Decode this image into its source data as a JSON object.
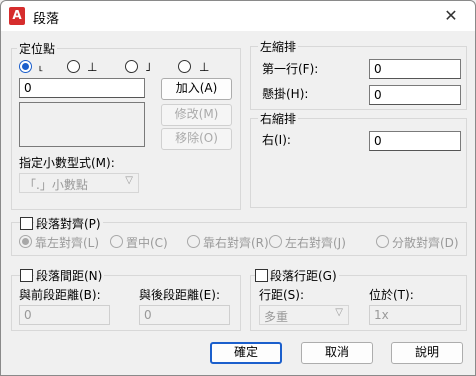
{
  "window": {
    "title": "段落",
    "app_icon_letter": "A",
    "close_glyph": "✕"
  },
  "tab_stops": {
    "label": "定位點",
    "types": [
      {
        "glyph": "˪",
        "selected": true
      },
      {
        "glyph": "⊥",
        "selected": false
      },
      {
        "glyph": "˩",
        "selected": false
      },
      {
        "glyph": "⊥",
        "selected": false
      }
    ],
    "position_value": "0",
    "add_button": "加入(A)",
    "modify_button": "修改(M)",
    "remove_button": "移除(O)",
    "decimal_label": "指定小數型式(M):",
    "decimal_value": "「.」小數點"
  },
  "left_indent": {
    "label": "左縮排",
    "first_line_label": "第一行(F):",
    "first_line_value": "0",
    "hanging_label": "懸掛(H):",
    "hanging_value": "0"
  },
  "right_indent": {
    "label": "右縮排",
    "right_label": "右(I):",
    "right_value": "0"
  },
  "alignment": {
    "label": "段落對齊(P)",
    "options": [
      "靠左對齊(L)",
      "置中(C)",
      "靠右對齊(R)",
      "左右對齊(J)",
      "分散對齊(D)"
    ]
  },
  "spacing": {
    "label": "段落間距(N)",
    "before_label": "與前段距離(B):",
    "before_value": "0",
    "after_label": "與後段距離(E):",
    "after_value": "0"
  },
  "line_spacing": {
    "label": "段落行距(G)",
    "spacing_label": "行距(S):",
    "spacing_value": "多重",
    "at_label": "位於(T):",
    "at_value": "1x"
  },
  "buttons": {
    "ok": "確定",
    "cancel": "取消",
    "help": "說明"
  }
}
